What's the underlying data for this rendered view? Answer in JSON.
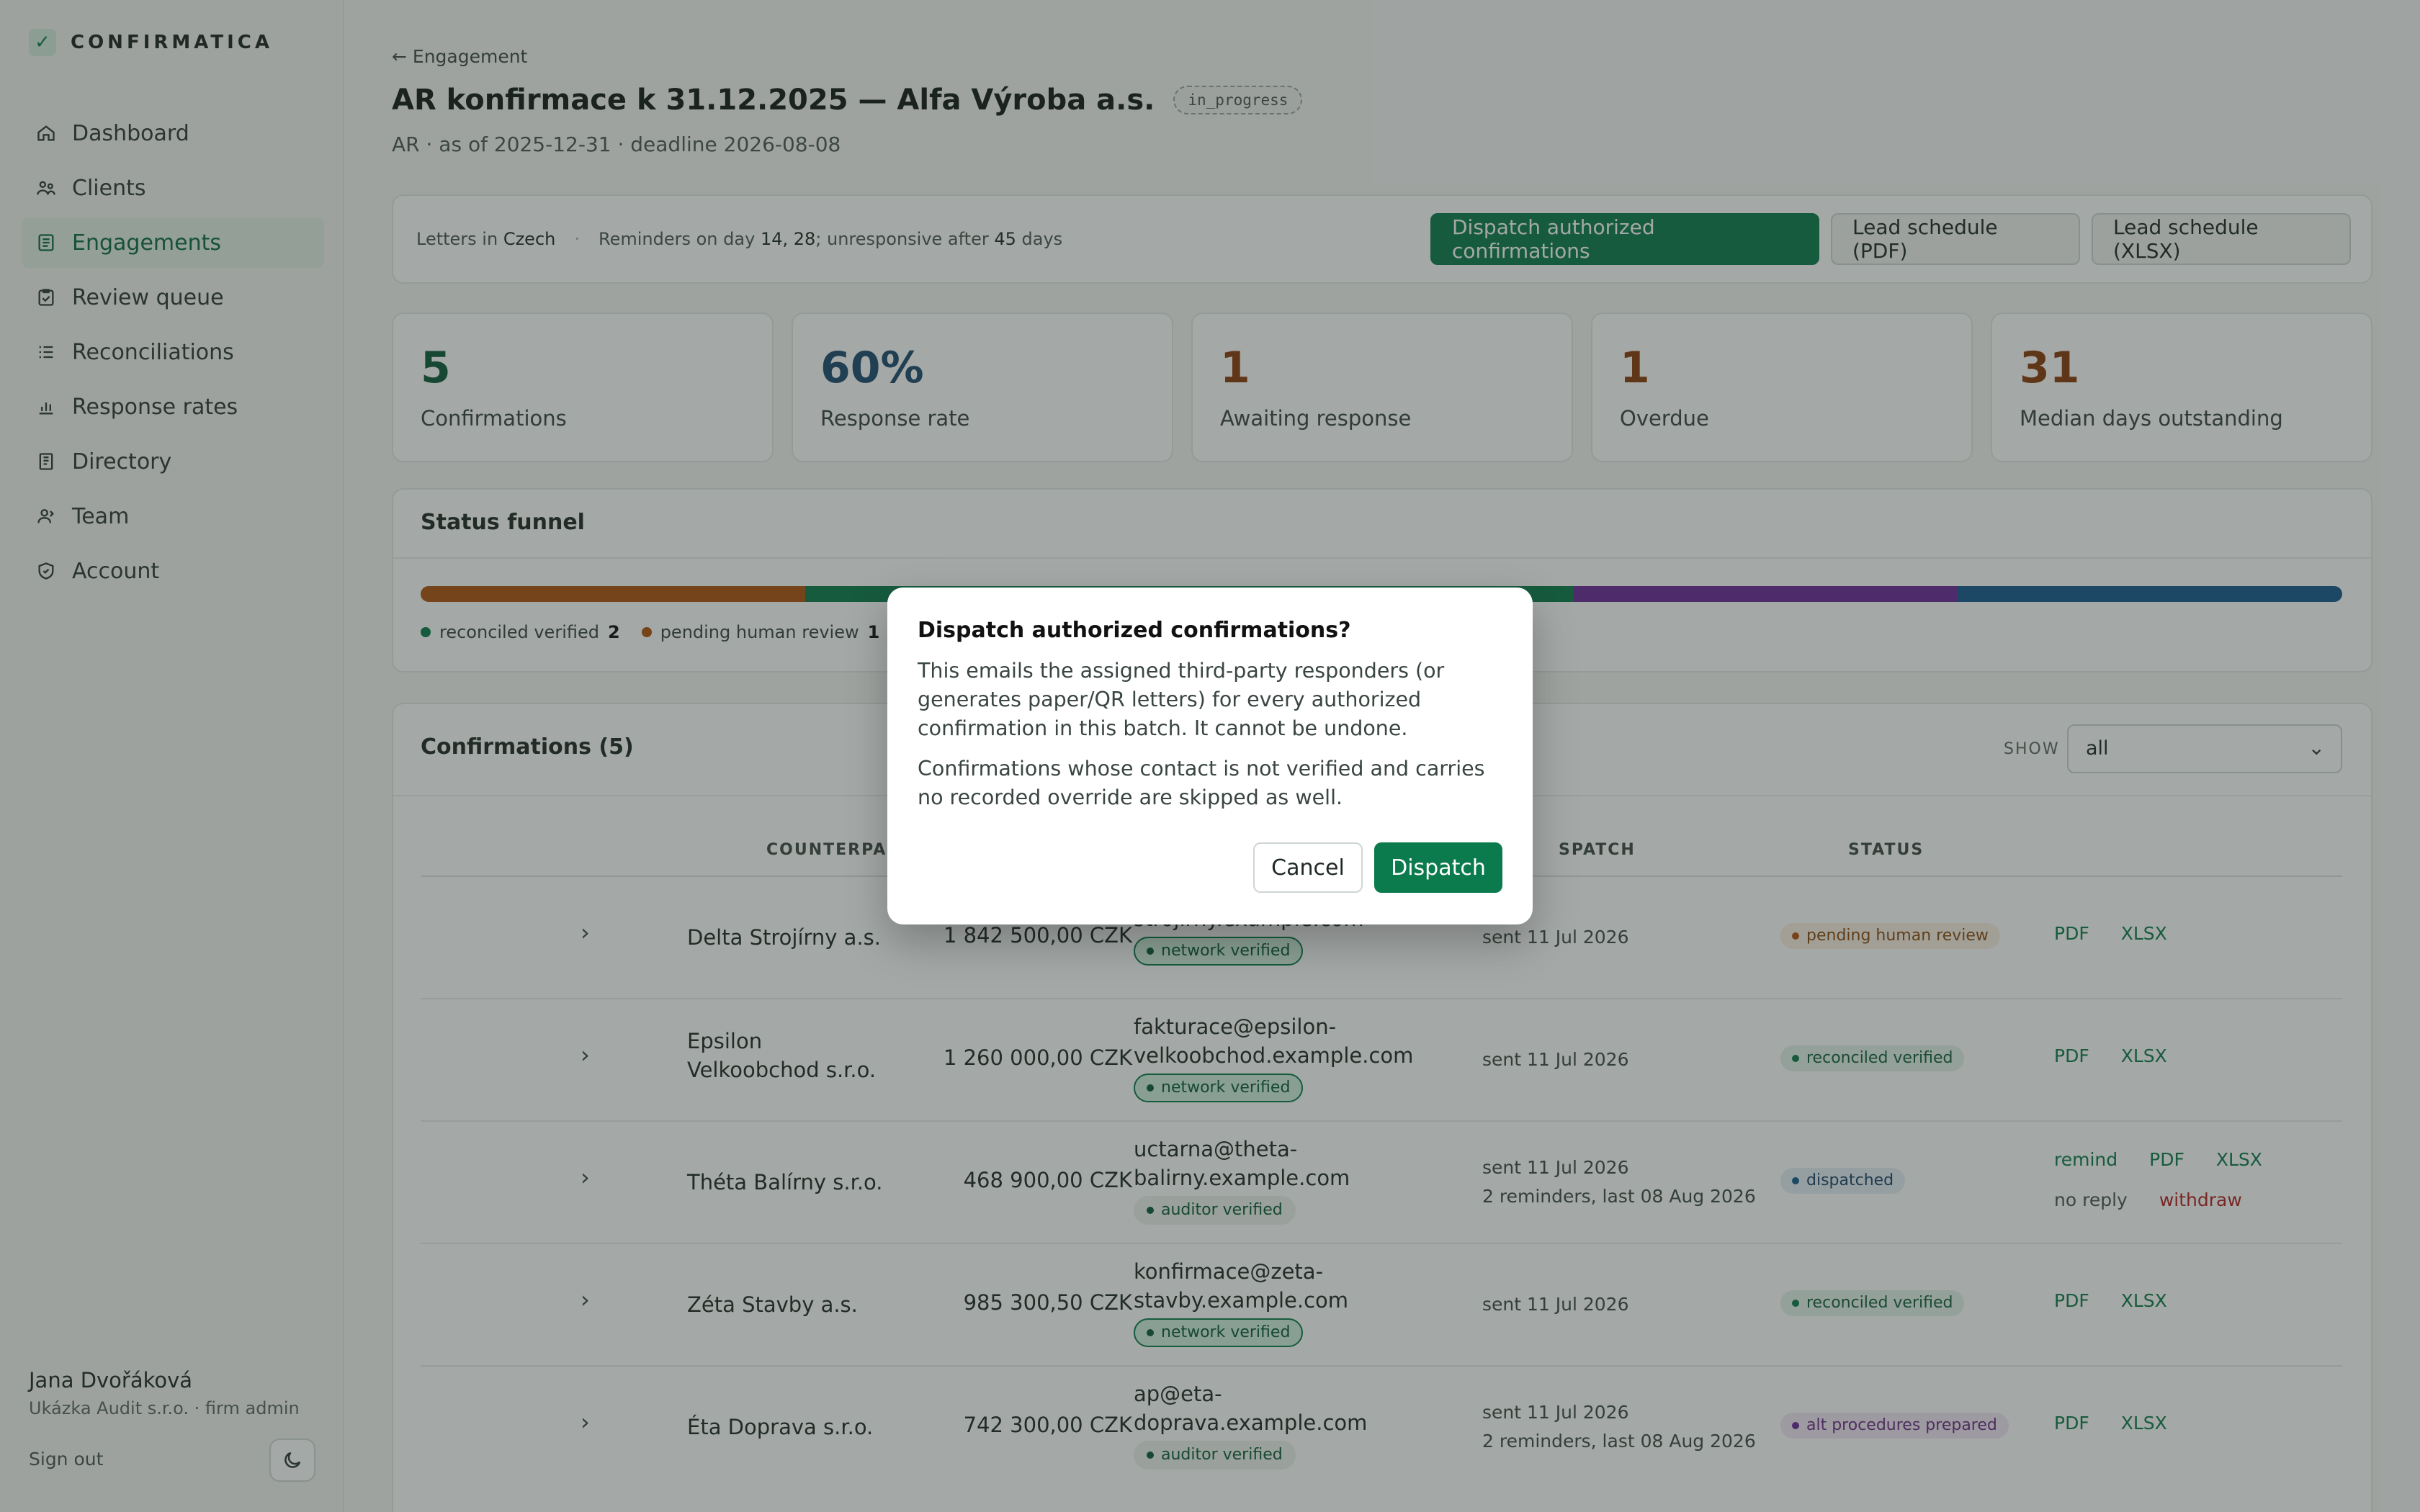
{
  "app": {
    "brand": "CONFIRMATICA"
  },
  "sidebar": {
    "items": [
      {
        "label": "Dashboard",
        "icon": "home-icon"
      },
      {
        "label": "Clients",
        "icon": "users-icon"
      },
      {
        "label": "Engagements",
        "icon": "clipboard-list-icon"
      },
      {
        "label": "Review queue",
        "icon": "clipboard-check-icon"
      },
      {
        "label": "Reconciliations",
        "icon": "list-icon"
      },
      {
        "label": "Response rates",
        "icon": "bar-chart-icon"
      },
      {
        "label": "Directory",
        "icon": "book-icon"
      },
      {
        "label": "Team",
        "icon": "team-icon"
      },
      {
        "label": "Account",
        "icon": "shield-icon"
      }
    ],
    "active": "Engagements",
    "user": {
      "name": "Jana Dvořáková",
      "org": "Ukázka Audit s.r.o. · firm admin"
    },
    "signout": "Sign out"
  },
  "header": {
    "back": "← Engagement",
    "title": "AR konfirmace k 31.12.2025 — Alfa Výroba a.s.",
    "status": "in_progress",
    "subtitle": "AR · as of 2025-12-31 · deadline 2026-08-08"
  },
  "toolbar": {
    "letters_prefix": "Letters in",
    "letters_lang": "Czech",
    "reminders_prefix": "Reminders on day",
    "reminder_days": "14, 28",
    "unresponsive_prefix": "; unresponsive after",
    "unresponsive_days": "45",
    "unresponsive_suffix": "days",
    "dispatch_label": "Dispatch authorized confirmations",
    "pdf_label": "Lead schedule (PDF)",
    "xlsx_label": "Lead schedule (XLSX)"
  },
  "stats": [
    {
      "value": "5",
      "label": "Confirmations",
      "color": "#0b5a3a"
    },
    {
      "value": "60%",
      "label": "Response rate",
      "color": "#1e4a6e"
    },
    {
      "value": "1",
      "label": "Awaiting response",
      "color": "#8a3b0c"
    },
    {
      "value": "1",
      "label": "Overdue",
      "color": "#8a3b0c"
    },
    {
      "value": "31",
      "label": "Median days outstanding",
      "color": "#8a3b0c"
    }
  ],
  "funnel": {
    "title": "Status funnel",
    "segments": [
      {
        "label": "pending human review",
        "count": 1,
        "color": "#b0540f"
      },
      {
        "label": "reconciled verified",
        "count": 2,
        "color": "#0b7a4d"
      },
      {
        "label": "alt procedures prepared",
        "count": 1,
        "color": "#6b2a9c"
      },
      {
        "label": "dispatched",
        "count": 1,
        "color": "#155a8f"
      }
    ],
    "legend": [
      {
        "label": "reconciled verified",
        "count": "2",
        "color": "#0b7a4d"
      },
      {
        "label": "pending human review",
        "count": "1",
        "color": "#b0540f"
      }
    ]
  },
  "confirmations": {
    "title": "Confirmations (5)",
    "show_label": "SHOW",
    "show_value": "all",
    "columns": {
      "counterparty": "COUNTERPARTY",
      "dispatch": "SPATCH",
      "status": "STATUS"
    },
    "rows": [
      {
        "counterparty": [
          "Delta Strojírny a.s."
        ],
        "amount": "1 842 500,00 CZK",
        "email": [
          "strojirny.example.com"
        ],
        "verification": "network verified",
        "dispatch": [
          "sent 11 Jul 2026"
        ],
        "status": "pending human review",
        "links": [
          "PDF",
          "XLSX"
        ]
      },
      {
        "counterparty": [
          "Epsilon",
          "Velkoobchod s.r.o."
        ],
        "amount": "1 260 000,00 CZK",
        "email": [
          "fakturace@epsilon-",
          "velkoobchod.example.com"
        ],
        "verification": "network verified",
        "dispatch": [
          "sent 11 Jul 2026"
        ],
        "status": "reconciled verified",
        "links": [
          "PDF",
          "XLSX"
        ]
      },
      {
        "counterparty": [
          "Théta Balírny s.r.o."
        ],
        "amount": "468 900,00 CZK",
        "email": [
          "uctarna@theta-",
          "balirny.example.com"
        ],
        "verification": "auditor verified",
        "dispatch": [
          "sent 11 Jul 2026",
          "2 reminders, last 08 Aug 2026"
        ],
        "status": "dispatched",
        "links": [
          "remind",
          "PDF",
          "XLSX"
        ],
        "links2": [
          "no reply",
          "withdraw"
        ]
      },
      {
        "counterparty": [
          "Zéta Stavby a.s."
        ],
        "amount": "985 300,50 CZK",
        "email": [
          "konfirmace@zeta-",
          "stavby.example.com"
        ],
        "verification": "network verified",
        "dispatch": [
          "sent 11 Jul 2026"
        ],
        "status": "reconciled verified",
        "links": [
          "PDF",
          "XLSX"
        ]
      },
      {
        "counterparty": [
          "Éta Doprava s.r.o."
        ],
        "amount": "742 300,00 CZK",
        "email": [
          "ap@eta-",
          "doprava.example.com"
        ],
        "verification": "auditor verified",
        "dispatch": [
          "sent 11 Jul 2026",
          "2 reminders, last 08 Aug 2026"
        ],
        "status": "alt procedures prepared",
        "links": [
          "PDF",
          "XLSX"
        ]
      }
    ]
  },
  "modal": {
    "title": "Dispatch authorized confirmations?",
    "body1": "This emails the assigned third-party responders (or generates paper/QR letters) for every authorized confirmation in this batch. It cannot be undone.",
    "body2": "Confirmations whose contact is not verified and carries no recorded override are skipped as well.",
    "cancel": "Cancel",
    "confirm": "Dispatch"
  }
}
